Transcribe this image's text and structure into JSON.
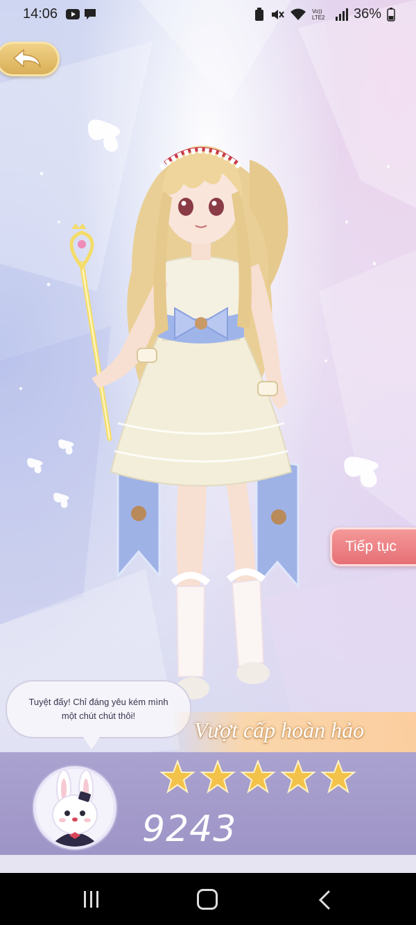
{
  "status_bar": {
    "time": "14:06",
    "battery": "36%",
    "network_label": "Vo)) LTE2"
  },
  "back_button": {
    "icon": "back-arrow-icon"
  },
  "continue_button": {
    "label": "Tiếp tục"
  },
  "speech_bubble": {
    "text": "Tuyệt đấy! Chỉ đáng yêu kém mình một chút chút thôi!"
  },
  "result": {
    "rating_title": "Vượt cấp hoàn hảo",
    "stars": 5,
    "stars_max": 5,
    "score": "9243"
  },
  "colors": {
    "accent_gold": "#d7ac55",
    "continue_red": "#e56e74",
    "panel_purple": "#a39bcb",
    "star_gold": "#f3c24a"
  },
  "nav_bar": {
    "recents_icon": "recents-icon",
    "home_icon": "home-icon",
    "back_icon": "nav-back-icon"
  }
}
